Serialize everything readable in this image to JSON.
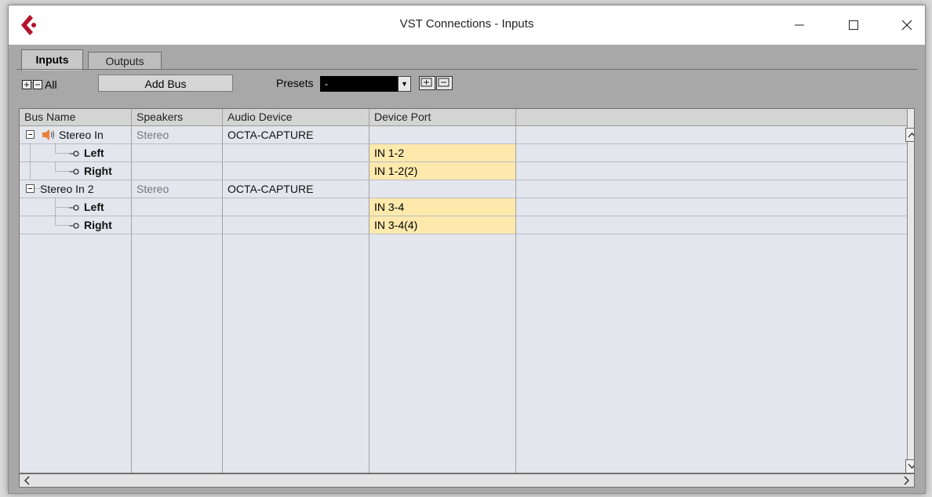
{
  "window": {
    "title": "VST Connections - Inputs",
    "controls": {
      "minimize": "—",
      "maximize": "☐",
      "close": "✕"
    }
  },
  "tabs": [
    {
      "label": "Inputs",
      "active": true
    },
    {
      "label": "Outputs",
      "active": false
    }
  ],
  "toolbar": {
    "all_label": "All",
    "add_bus_label": "Add Bus",
    "presets_label": "Presets",
    "presets_value": "-"
  },
  "table": {
    "columns": [
      "Bus Name",
      "Speakers",
      "Audio Device",
      "Device Port"
    ],
    "rows": [
      {
        "bus": "Stereo In",
        "speakers": "Stereo",
        "device": "OCTA-CAPTURE",
        "port": ""
      },
      {
        "bus": "Left",
        "speakers": "",
        "device": "",
        "port": "IN 1-2"
      },
      {
        "bus": "Right",
        "speakers": "",
        "device": "",
        "port": "IN 1-2(2)"
      },
      {
        "bus": "Stereo In 2",
        "speakers": "Stereo",
        "device": "OCTA-CAPTURE",
        "port": ""
      },
      {
        "bus": "Left",
        "speakers": "",
        "device": "",
        "port": "IN 3-4"
      },
      {
        "bus": "Right",
        "speakers": "",
        "device": "",
        "port": "IN 3-4(4)"
      }
    ]
  },
  "colors": {
    "port_highlight": "#fde9ac",
    "grid_bg": "#e3e6ec",
    "logo_red": "#b5122b"
  }
}
